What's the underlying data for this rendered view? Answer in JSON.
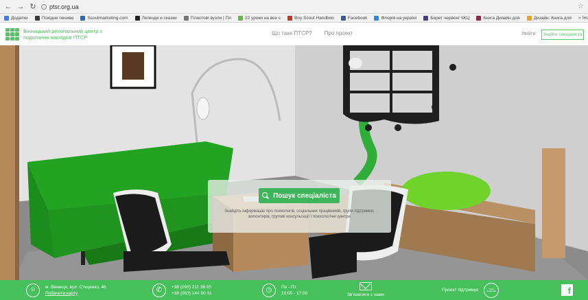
{
  "browser": {
    "url": "ptsr.org.ua",
    "bookmarks": [
      {
        "label": "Додатки",
        "color": "#4a7bd8"
      },
      {
        "label": "Похідне печиво",
        "color": "#3b3b3b"
      },
      {
        "label": "Scoutmarketing.com",
        "color": "#2b6cb0"
      },
      {
        "label": "Легенди и сказки",
        "color": "#222222"
      },
      {
        "label": "Пластові вузли | Пл",
        "color": "#777777"
      },
      {
        "label": "22 уроки на все с",
        "color": "#6bb34a"
      },
      {
        "label": "Boy Scout Handboo",
        "color": "#c0392b"
      },
      {
        "label": "Facebook",
        "color": "#3b5998"
      },
      {
        "label": "Флорія на україні",
        "color": "#2e86de"
      },
      {
        "label": "Берет червоні ЧКЦ",
        "color": "#4a3a8a"
      },
      {
        "label": "Книга Дизайн для",
        "color": "#8e2c48"
      },
      {
        "label": "Дизайн: Книга для",
        "color": "#e1a33c"
      }
    ],
    "bookmarks_more": "»  Інші закладки"
  },
  "header": {
    "logo_text": "Вінницький регіональний центр з подолання наслідків ПТСР",
    "nav": [
      "Що таке ПТСР?",
      "Про проект"
    ],
    "login": "Увійти",
    "find_button": "Знайти спеціаліста"
  },
  "hero": {
    "search_button": "Пошук спеціаліста",
    "description": "Знайдіть інформацію про психологів, соціальних працівників, групи підтримки, волонтерів, групові консультації і психологічні центри"
  },
  "footer": {
    "address": "м. Вінниця, вул. Стеценко, 46",
    "map_link": "Побачити карту",
    "phone1": "+38 (096) 211 36 85",
    "phone2": "+38 (063) 144 90 31",
    "hours_days": "Пн - Пт",
    "hours_time": "10:00 - 17:00",
    "email_label": "Зв'язатися з нами",
    "partner_label": "Проект підтримує",
    "partner_logo_text": "Гідна Ініціатива"
  },
  "colors": {
    "brand_green": "#45c05a",
    "logo_green": "#5cc16a"
  }
}
